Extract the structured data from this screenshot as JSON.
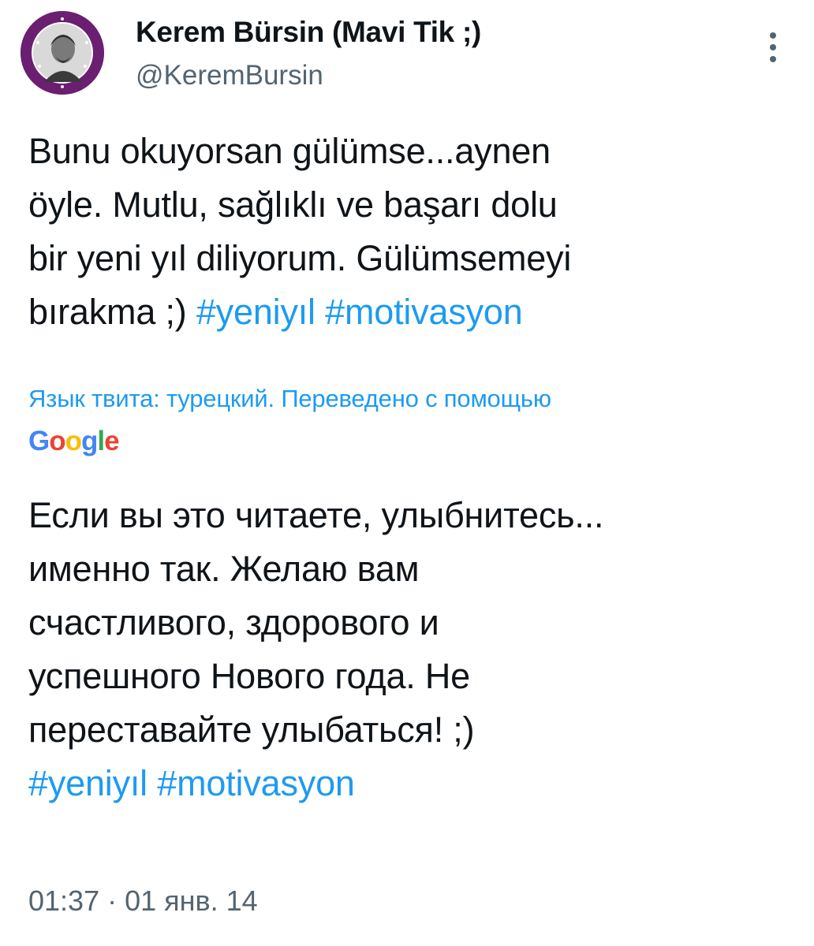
{
  "author": {
    "display_name": "Kerem Bürsin (Mavi Tik ;)",
    "handle": "@KeremBursin",
    "avatar_icon": "profile-photo-circle-badge"
  },
  "tweet": {
    "original_lines": [
      {
        "text": "Bunu okuyorsan gülümse...aynen"
      },
      {
        "text": "öyle. Mutlu, sağlıklı ve başarı dolu"
      },
      {
        "text": "bir yeni yıl diliyorum. Gülümsemeyi"
      },
      {
        "text": "bırakma ;) ",
        "tags": [
          "#yeniyıl",
          "#motivasyon"
        ]
      }
    ],
    "translation_note": "Язык твита: турецкий. Переведено с помощью",
    "translation_provider": "Google",
    "translated_lines": [
      {
        "text": "Если вы это читаете, улыбнитесь..."
      },
      {
        "text": "именно так. Желаю вам"
      },
      {
        "text": "счастливого, здорового и"
      },
      {
        "text": "успешного Нового года. Не"
      },
      {
        "text": "переставайте улыбаться! ;)"
      },
      {
        "text": "",
        "tags": [
          "#yeniyıl",
          "#motivasyon"
        ]
      }
    ],
    "timestamp": "01:37 · 01 янв. 14"
  },
  "colors": {
    "link": "#1d9bf0",
    "text": "#0f1419",
    "secondary_text": "#536471",
    "google": [
      "#4285F4",
      "#EA4335",
      "#FBBC05",
      "#4285F4",
      "#34A853",
      "#EA4335"
    ]
  },
  "icons": {
    "more": "more-vertical-icon"
  }
}
